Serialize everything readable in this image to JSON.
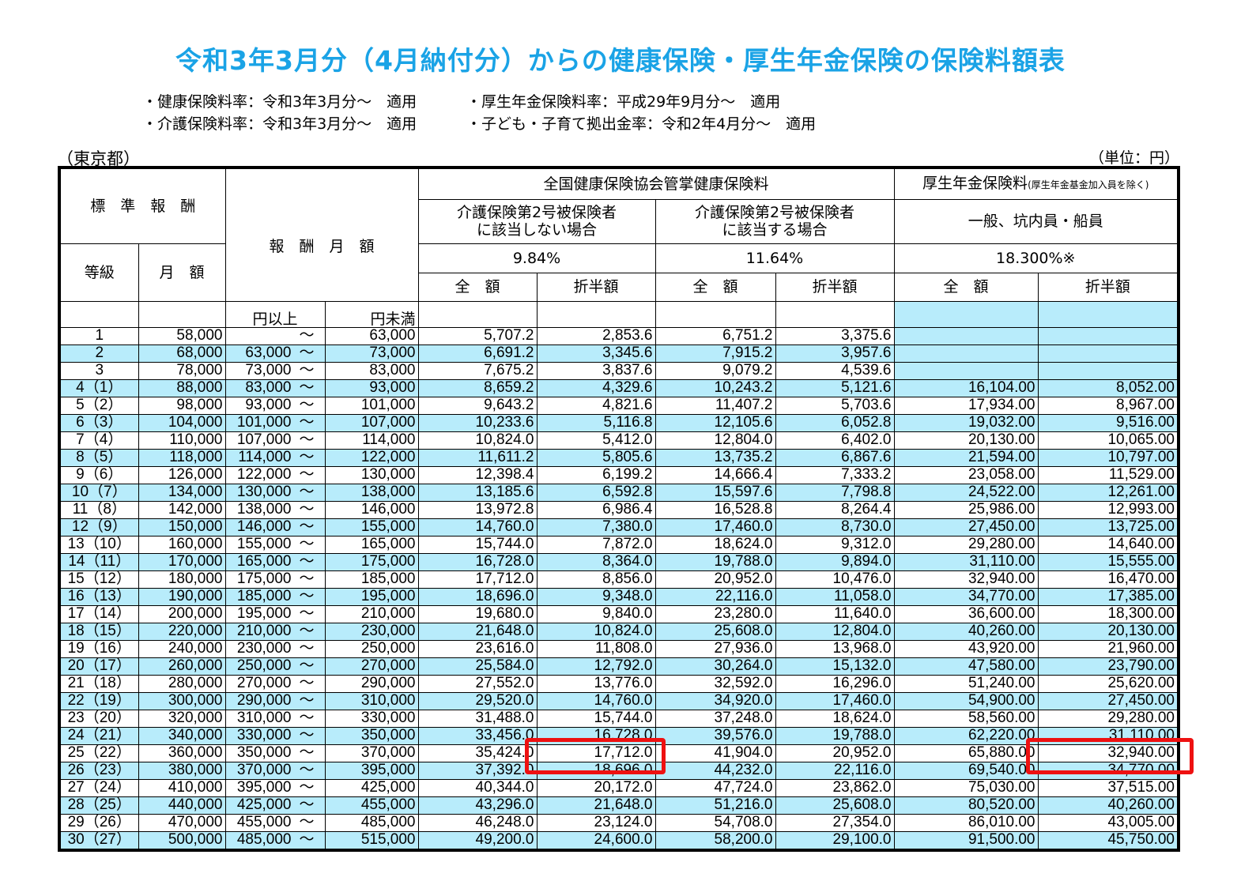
{
  "title": "令和3年3月分（4月納付分）からの健康保険・厚生年金保険の保険料額表",
  "notes": {
    "health_rate": "・健康保険料率：令和3年3月分～　適用",
    "pension_rate": "・厚生年金保険料率：平成29年9月分～　適用",
    "care_rate": "・介護保険料率：令和3年3月分～　適用",
    "child_rate": "・子ども・子育て拠出金率：令和2年4月分～　適用"
  },
  "region": "（東京都）",
  "unit": "（単位：円）",
  "header": {
    "standard_reward": "標　準　報　酬",
    "monthly_reward": "報　酬　月　額",
    "grade": "等級",
    "monthly_amount": "月　額",
    "kyokai": "全国健康保険協会管掌健康保険料",
    "pension": "厚生年金保険料",
    "pension_note": "(厚生年金基金加入員を除く)",
    "no_care_line1": "介護保険第2号被保険者",
    "no_care_line2": "に該当しない場合",
    "care_line1": "介護保険第2号被保険者",
    "care_line2": "に該当する場合",
    "general": "一般、坑内員・船員",
    "rate_no_care": "9.84%",
    "rate_care": "11.64%",
    "rate_pension": "18.300%※",
    "full": "全　額",
    "half": "折半額",
    "yen_from": "円以上",
    "yen_to": "円未満"
  },
  "rows": [
    {
      "grade": "1",
      "monthly": "58,000",
      "from": "",
      "to": "63,000",
      "h_full": "5,707.2",
      "h_half": "2,853.6",
      "c_full": "6,751.2",
      "c_half": "3,375.6",
      "p_full": "",
      "p_half": ""
    },
    {
      "grade": "2",
      "monthly": "68,000",
      "from": "63,000",
      "to": "73,000",
      "h_full": "6,691.2",
      "h_half": "3,345.6",
      "c_full": "7,915.2",
      "c_half": "3,957.6",
      "p_full": "",
      "p_half": ""
    },
    {
      "grade": "3",
      "monthly": "78,000",
      "from": "73,000",
      "to": "83,000",
      "h_full": "7,675.2",
      "h_half": "3,837.6",
      "c_full": "9,079.2",
      "c_half": "4,539.6",
      "p_full": "",
      "p_half": ""
    },
    {
      "grade": "4（1）",
      "monthly": "88,000",
      "from": "83,000",
      "to": "93,000",
      "h_full": "8,659.2",
      "h_half": "4,329.6",
      "c_full": "10,243.2",
      "c_half": "5,121.6",
      "p_full": "16,104.00",
      "p_half": "8,052.00"
    },
    {
      "grade": "5（2）",
      "monthly": "98,000",
      "from": "93,000",
      "to": "101,000",
      "h_full": "9,643.2",
      "h_half": "4,821.6",
      "c_full": "11,407.2",
      "c_half": "5,703.6",
      "p_full": "17,934.00",
      "p_half": "8,967.00"
    },
    {
      "grade": "6（3）",
      "monthly": "104,000",
      "from": "101,000",
      "to": "107,000",
      "h_full": "10,233.6",
      "h_half": "5,116.8",
      "c_full": "12,105.6",
      "c_half": "6,052.8",
      "p_full": "19,032.00",
      "p_half": "9,516.00"
    },
    {
      "grade": "7（4）",
      "monthly": "110,000",
      "from": "107,000",
      "to": "114,000",
      "h_full": "10,824.0",
      "h_half": "5,412.0",
      "c_full": "12,804.0",
      "c_half": "6,402.0",
      "p_full": "20,130.00",
      "p_half": "10,065.00"
    },
    {
      "grade": "8（5）",
      "monthly": "118,000",
      "from": "114,000",
      "to": "122,000",
      "h_full": "11,611.2",
      "h_half": "5,805.6",
      "c_full": "13,735.2",
      "c_half": "6,867.6",
      "p_full": "21,594.00",
      "p_half": "10,797.00"
    },
    {
      "grade": "9（6）",
      "monthly": "126,000",
      "from": "122,000",
      "to": "130,000",
      "h_full": "12,398.4",
      "h_half": "6,199.2",
      "c_full": "14,666.4",
      "c_half": "7,333.2",
      "p_full": "23,058.00",
      "p_half": "11,529.00"
    },
    {
      "grade": "10（7）",
      "monthly": "134,000",
      "from": "130,000",
      "to": "138,000",
      "h_full": "13,185.6",
      "h_half": "6,592.8",
      "c_full": "15,597.6",
      "c_half": "7,798.8",
      "p_full": "24,522.00",
      "p_half": "12,261.00"
    },
    {
      "grade": "11（8）",
      "monthly": "142,000",
      "from": "138,000",
      "to": "146,000",
      "h_full": "13,972.8",
      "h_half": "6,986.4",
      "c_full": "16,528.8",
      "c_half": "8,264.4",
      "p_full": "25,986.00",
      "p_half": "12,993.00"
    },
    {
      "grade": "12（9）",
      "monthly": "150,000",
      "from": "146,000",
      "to": "155,000",
      "h_full": "14,760.0",
      "h_half": "7,380.0",
      "c_full": "17,460.0",
      "c_half": "8,730.0",
      "p_full": "27,450.00",
      "p_half": "13,725.00"
    },
    {
      "grade": "13（10）",
      "monthly": "160,000",
      "from": "155,000",
      "to": "165,000",
      "h_full": "15,744.0",
      "h_half": "7,872.0",
      "c_full": "18,624.0",
      "c_half": "9,312.0",
      "p_full": "29,280.00",
      "p_half": "14,640.00"
    },
    {
      "grade": "14（11）",
      "monthly": "170,000",
      "from": "165,000",
      "to": "175,000",
      "h_full": "16,728.0",
      "h_half": "8,364.0",
      "c_full": "19,788.0",
      "c_half": "9,894.0",
      "p_full": "31,110.00",
      "p_half": "15,555.00"
    },
    {
      "grade": "15（12）",
      "monthly": "180,000",
      "from": "175,000",
      "to": "185,000",
      "h_full": "17,712.0",
      "h_half": "8,856.0",
      "c_full": "20,952.0",
      "c_half": "10,476.0",
      "p_full": "32,940.00",
      "p_half": "16,470.00"
    },
    {
      "grade": "16（13）",
      "monthly": "190,000",
      "from": "185,000",
      "to": "195,000",
      "h_full": "18,696.0",
      "h_half": "9,348.0",
      "c_full": "22,116.0",
      "c_half": "11,058.0",
      "p_full": "34,770.00",
      "p_half": "17,385.00"
    },
    {
      "grade": "17（14）",
      "monthly": "200,000",
      "from": "195,000",
      "to": "210,000",
      "h_full": "19,680.0",
      "h_half": "9,840.0",
      "c_full": "23,280.0",
      "c_half": "11,640.0",
      "p_full": "36,600.00",
      "p_half": "18,300.00"
    },
    {
      "grade": "18（15）",
      "monthly": "220,000",
      "from": "210,000",
      "to": "230,000",
      "h_full": "21,648.0",
      "h_half": "10,824.0",
      "c_full": "25,608.0",
      "c_half": "12,804.0",
      "p_full": "40,260.00",
      "p_half": "20,130.00"
    },
    {
      "grade": "19（16）",
      "monthly": "240,000",
      "from": "230,000",
      "to": "250,000",
      "h_full": "23,616.0",
      "h_half": "11,808.0",
      "c_full": "27,936.0",
      "c_half": "13,968.0",
      "p_full": "43,920.00",
      "p_half": "21,960.00"
    },
    {
      "grade": "20（17）",
      "monthly": "260,000",
      "from": "250,000",
      "to": "270,000",
      "h_full": "25,584.0",
      "h_half": "12,792.0",
      "c_full": "30,264.0",
      "c_half": "15,132.0",
      "p_full": "47,580.00",
      "p_half": "23,790.00"
    },
    {
      "grade": "21（18）",
      "monthly": "280,000",
      "from": "270,000",
      "to": "290,000",
      "h_full": "27,552.0",
      "h_half": "13,776.0",
      "c_full": "32,592.0",
      "c_half": "16,296.0",
      "p_full": "51,240.00",
      "p_half": "25,620.00"
    },
    {
      "grade": "22（19）",
      "monthly": "300,000",
      "from": "290,000",
      "to": "310,000",
      "h_full": "29,520.0",
      "h_half": "14,760.0",
      "c_full": "34,920.0",
      "c_half": "17,460.0",
      "p_full": "54,900.00",
      "p_half": "27,450.00"
    },
    {
      "grade": "23（20）",
      "monthly": "320,000",
      "from": "310,000",
      "to": "330,000",
      "h_full": "31,488.0",
      "h_half": "15,744.0",
      "c_full": "37,248.0",
      "c_half": "18,624.0",
      "p_full": "58,560.00",
      "p_half": "29,280.00"
    },
    {
      "grade": "24（21）",
      "monthly": "340,000",
      "from": "330,000",
      "to": "350,000",
      "h_full": "33,456.0",
      "h_half": "16,728.0",
      "c_full": "39,576.0",
      "c_half": "19,788.0",
      "p_full": "62,220.00",
      "p_half": "31,110.00"
    },
    {
      "grade": "25（22）",
      "monthly": "360,000",
      "from": "350,000",
      "to": "370,000",
      "h_full": "35,424.0",
      "h_half": "17,712.0",
      "c_full": "41,904.0",
      "c_half": "20,952.0",
      "p_full": "65,880.00",
      "p_half": "32,940.00"
    },
    {
      "grade": "26（23）",
      "monthly": "380,000",
      "from": "370,000",
      "to": "395,000",
      "h_full": "37,392.0",
      "h_half": "18,696.0",
      "c_full": "44,232.0",
      "c_half": "22,116.0",
      "p_full": "69,540.00",
      "p_half": "34,770.00"
    },
    {
      "grade": "27（24）",
      "monthly": "410,000",
      "from": "395,000",
      "to": "425,000",
      "h_full": "40,344.0",
      "h_half": "20,172.0",
      "c_full": "47,724.0",
      "c_half": "23,862.0",
      "p_full": "75,030.00",
      "p_half": "37,515.00"
    },
    {
      "grade": "28（25）",
      "monthly": "440,000",
      "from": "425,000",
      "to": "455,000",
      "h_full": "43,296.0",
      "h_half": "21,648.0",
      "c_full": "51,216.0",
      "c_half": "25,608.0",
      "p_full": "80,520.00",
      "p_half": "40,260.00"
    },
    {
      "grade": "29（26）",
      "monthly": "470,000",
      "from": "455,000",
      "to": "485,000",
      "h_full": "46,248.0",
      "h_half": "23,124.0",
      "c_full": "54,708.0",
      "c_half": "27,354.0",
      "p_full": "86,010.00",
      "p_half": "43,005.00"
    },
    {
      "grade": "30（27）",
      "monthly": "500,000",
      "from": "485,000",
      "to": "515,000",
      "h_full": "49,200.0",
      "h_half": "24,600.0",
      "c_full": "58,200.0",
      "c_half": "29,100.0",
      "p_full": "91,500.00",
      "p_half": "45,750.00"
    }
  ],
  "colors": {
    "title": "#1aa3e6",
    "row_shade": "#b8ecfb",
    "highlight": "#ee1111"
  }
}
